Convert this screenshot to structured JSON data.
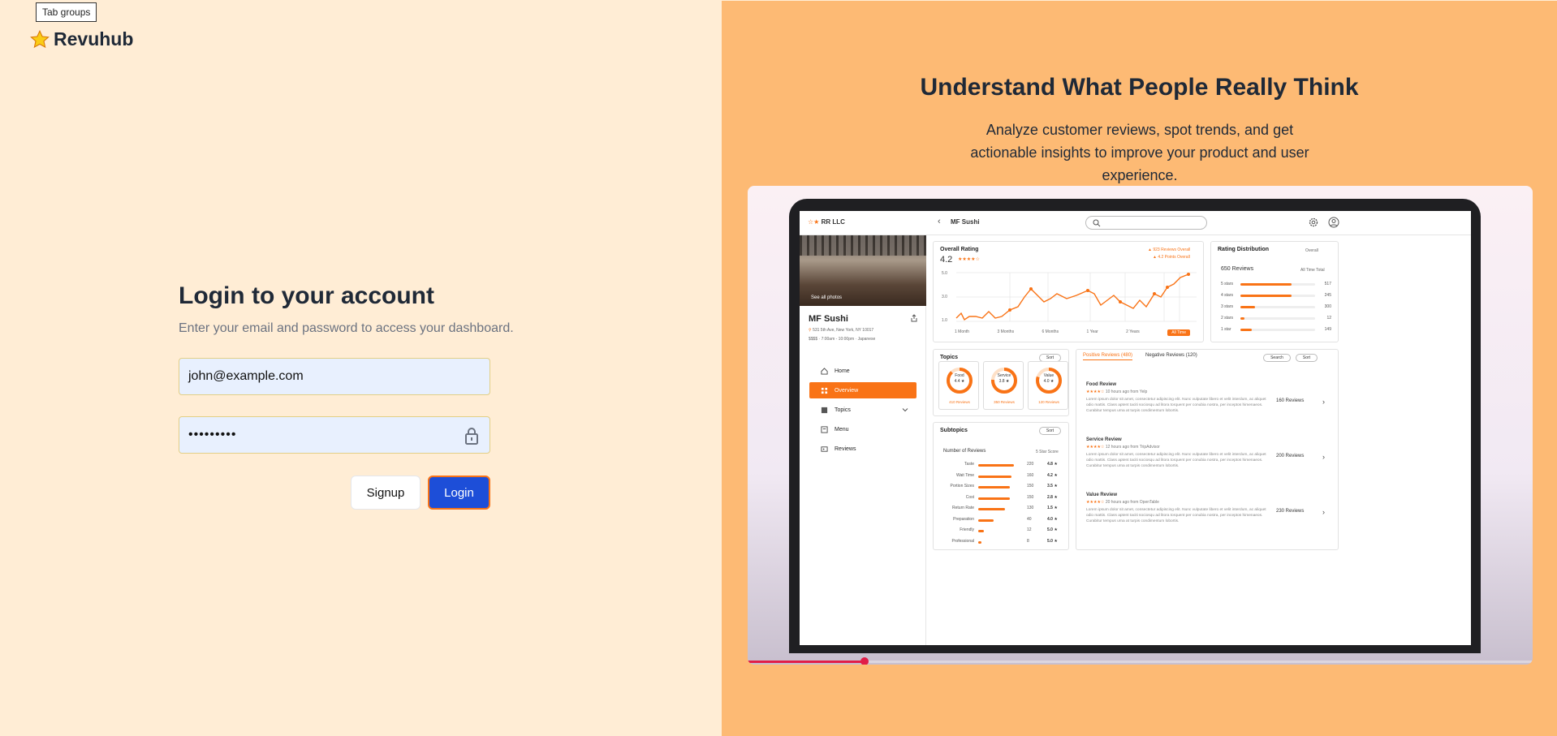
{
  "tooltip": {
    "text": "Tab groups"
  },
  "brand": {
    "icon": "star-icon",
    "name": "Revuhub"
  },
  "login": {
    "title": "Login to your account",
    "subtitle": "Enter your email and password to access your dashboard.",
    "email_value": "john@example.com",
    "password_masked": "•••••••••",
    "signup_label": "Signup",
    "login_label": "Login"
  },
  "colors": {
    "left_bg": "#ffedd5",
    "right_bg": "#fdba74",
    "primary_button": "#1d4ed8",
    "accent": "#f97316",
    "input_bg": "#e8f0fe"
  },
  "hero": {
    "title": "Understand What People Really Think",
    "subtitle": "Analyze customer reviews, spot trends, and get actionable insights to improve your product and user experience."
  },
  "preview": {
    "video_progress_fraction": 0.15,
    "topbar": {
      "logo_stars": "☆★",
      "company": "RR LLC",
      "crumb": "MF Sushi"
    },
    "sidebar": {
      "photo_label": "See all photos",
      "place_name": "MF Sushi",
      "address": "531 5th Ave, New York, NY 10017",
      "hours": "$$$$ · 7:00am - 10:00pm · Japanese",
      "nav": [
        {
          "label": "Home",
          "icon": "home-icon"
        },
        {
          "label": "Overview",
          "icon": "grid-icon"
        },
        {
          "label": "Topics",
          "icon": "list-icon"
        },
        {
          "label": "Menu",
          "icon": "menu-icon"
        },
        {
          "label": "Reviews",
          "icon": "reviews-icon"
        }
      ]
    },
    "overall": {
      "title": "Overall Rating",
      "value": "4.2",
      "stars": "★★★★☆",
      "reviews_note": "▲ 923 Reviews Overall",
      "points_note": "▲ 4.2 Points Overall",
      "y_ticks": [
        "5.0",
        "3.0",
        "1.0"
      ],
      "ranges": [
        "1 Month",
        "3 Months",
        "6 Months",
        "1 Year",
        "2 Years",
        "All Time"
      ]
    },
    "distribution": {
      "title": "Rating Distribution",
      "filter": "Overall",
      "total": "650 Reviews",
      "period": "All Time Total",
      "rows": [
        {
          "label": "5 stars",
          "count": "517",
          "fraction": 0.68
        },
        {
          "label": "4 stars",
          "count": "245",
          "fraction": 0.68
        },
        {
          "label": "3 stars",
          "count": "300",
          "fraction": 0.2
        },
        {
          "label": "2 stars",
          "count": "12",
          "fraction": 0.05
        },
        {
          "label": "1 star",
          "count": "149",
          "fraction": 0.15
        }
      ]
    },
    "topics": {
      "title": "Topics",
      "sort": "Sort",
      "items": [
        {
          "name": "Food",
          "score": "4.4 ★",
          "reviews": "410 Reviews",
          "fraction": 0.88
        },
        {
          "name": "Service",
          "score": "3.8 ★",
          "reviews": "350 Reviews",
          "fraction": 0.76
        },
        {
          "name": "Value",
          "score": "4.0 ★",
          "reviews": "120 Reviews",
          "fraction": 0.8
        }
      ]
    },
    "subtopics": {
      "title": "Subtopics",
      "sort": "Sort",
      "col_left": "Number of Reviews",
      "col_right": "5 Star Score",
      "rows": [
        {
          "name": "Taste",
          "count": "220",
          "score": "4.8 ★",
          "fraction": 0.8
        },
        {
          "name": "Wait Time",
          "count": "160",
          "score": "4.2 ★",
          "fraction": 0.75
        },
        {
          "name": "Portion Sizes",
          "count": "150",
          "score": "3.5 ★",
          "fraction": 0.7
        },
        {
          "name": "Cost",
          "count": "150",
          "score": "2.8 ★",
          "fraction": 0.7
        },
        {
          "name": "Return Rate",
          "count": "130",
          "score": "1.5 ★",
          "fraction": 0.6
        },
        {
          "name": "Preparation",
          "count": "40",
          "score": "4.0 ★",
          "fraction": 0.35
        },
        {
          "name": "Friendly",
          "count": "12",
          "score": "5.0 ★",
          "fraction": 0.12
        },
        {
          "name": "Professional",
          "count": "8",
          "score": "5.0 ★",
          "fraction": 0.08
        }
      ]
    },
    "reviews_panel": {
      "tab_positive": "Positive Reviews (480)",
      "tab_negative": "Negative Reviews (120)",
      "search": "Search",
      "sort": "Sort",
      "items": [
        {
          "title": "Food Review",
          "stars": "★★★★☆",
          "meta": "10 hours ago from Yelp",
          "count": "160 Reviews"
        },
        {
          "title": "Service Review",
          "stars": "★★★★☆",
          "meta": "12 hours ago from TripAdvisor",
          "count": "200 Reviews"
        },
        {
          "title": "Value Review",
          "stars": "★★★★☆",
          "meta": "20 hours ago from OpenTable",
          "count": "230 Reviews"
        }
      ],
      "body": "Lorem ipsum dolor sit amet, consectetur adipiscing elit. Nunc vulputate libero et velit interdum, ac aliquet odio mattis. Class aptent taciti sociosqu ad litora torquent per conubia nostra, per inceptos himenaeos. Curabitur tempus urna at turpis condimentum lobortis."
    }
  }
}
